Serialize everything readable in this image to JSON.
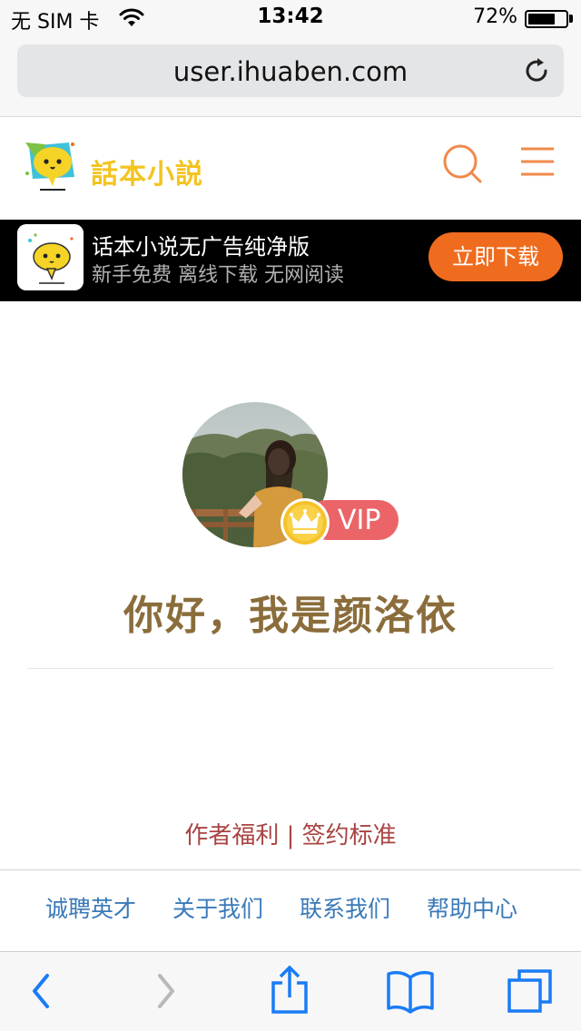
{
  "status_bar": {
    "carrier": "无 SIM 卡",
    "time": "13:42",
    "battery": "72%",
    "battery_level": 0.72
  },
  "browser": {
    "url": "user.ihuaben.com"
  },
  "site": {
    "logo_text": "話本小説"
  },
  "banner": {
    "title": "话本小说无广告纯净版",
    "subtitle": "新手免费 离线下载 无网阅读",
    "button": "立即下载"
  },
  "profile": {
    "vip_label": "VIP",
    "greeting": "你好，我是颜洛依"
  },
  "author_links": {
    "welfare": "作者福利",
    "separator": "|",
    "contract": "签约标准"
  },
  "footer": {
    "links": [
      "诚聘英才",
      "关于我们",
      "联系我们",
      "帮助中心"
    ]
  },
  "colors": {
    "accent_orange": "#ef6c1e",
    "logo_yellow": "#f3c41f",
    "greeting_brown": "#8a6d3b",
    "vip_red": "#ea6468",
    "link_blue": "#3a7ab8",
    "ios_blue": "#1a7cf5"
  }
}
